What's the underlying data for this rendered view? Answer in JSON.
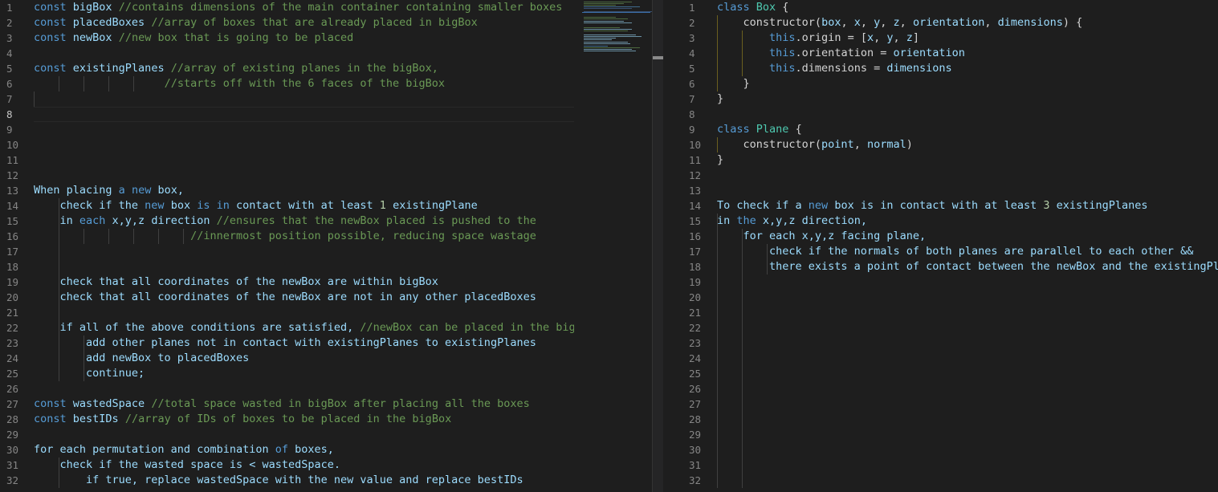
{
  "left_editor": {
    "active_line": 8,
    "lines": [
      {
        "n": "1",
        "t": [
          [
            "kw",
            "const "
          ],
          [
            "var",
            "bigBox "
          ],
          [
            "cmt",
            "//contains dimensions of the main container containing smaller boxes"
          ]
        ]
      },
      {
        "n": "2",
        "t": [
          [
            "kw",
            "const "
          ],
          [
            "var",
            "placedBoxes "
          ],
          [
            "cmt",
            "//array of boxes that are already placed in bigBox"
          ]
        ]
      },
      {
        "n": "3",
        "t": [
          [
            "kw",
            "const "
          ],
          [
            "var",
            "newBox "
          ],
          [
            "cmt",
            "//new box that is going to be placed"
          ]
        ]
      },
      {
        "n": "4",
        "t": []
      },
      {
        "n": "5",
        "t": [
          [
            "kw",
            "const "
          ],
          [
            "var",
            "existingPlanes "
          ],
          [
            "cmt",
            "//array of existing planes in the bigBox,"
          ]
        ]
      },
      {
        "n": "6",
        "t": [
          [
            "",
            "                    "
          ],
          [
            "cmt",
            "//starts off with the 6 faces of the bigBox"
          ]
        ]
      },
      {
        "n": "7",
        "t": []
      },
      {
        "n": "8",
        "t": []
      },
      {
        "n": "9",
        "t": []
      },
      {
        "n": "10",
        "t": []
      },
      {
        "n": "11",
        "t": []
      },
      {
        "n": "12",
        "t": []
      },
      {
        "n": "13",
        "t": [
          [
            "var",
            "When placing "
          ],
          [
            "kw",
            "a "
          ],
          [
            "kw",
            "new "
          ],
          [
            "var",
            "box,"
          ]
        ]
      },
      {
        "n": "14",
        "t": [
          [
            "var",
            "    check if the "
          ],
          [
            "kw",
            "new "
          ],
          [
            "var",
            "box "
          ],
          [
            "kw",
            "is in "
          ],
          [
            "var",
            "contact with at least "
          ],
          [
            "num",
            "1 "
          ],
          [
            "var",
            "existingPlane"
          ]
        ]
      },
      {
        "n": "15",
        "t": [
          [
            "var",
            "    in "
          ],
          [
            "kw",
            "each "
          ],
          [
            "var",
            "x,y,z direction "
          ],
          [
            "cmt",
            "//ensures that the newBox placed is pushed to the"
          ]
        ]
      },
      {
        "n": "16",
        "t": [
          [
            "",
            "                        "
          ],
          [
            "cmt",
            "//innermost position possible, reducing space wastage"
          ]
        ]
      },
      {
        "n": "17",
        "t": []
      },
      {
        "n": "18",
        "t": []
      },
      {
        "n": "19",
        "t": [
          [
            "var",
            "    check that all coordinates of the newBox are within bigBox"
          ]
        ]
      },
      {
        "n": "20",
        "t": [
          [
            "var",
            "    check that all coordinates of the newBox are not in any other placedBoxes"
          ]
        ]
      },
      {
        "n": "21",
        "t": []
      },
      {
        "n": "22",
        "t": [
          [
            "var",
            "    if all of the above conditions are satisfied, "
          ],
          [
            "cmt",
            "//newBox can be placed in the bigBox"
          ]
        ]
      },
      {
        "n": "23",
        "t": [
          [
            "var",
            "        add other planes not in contact with existingPlanes to existingPlanes"
          ]
        ]
      },
      {
        "n": "24",
        "t": [
          [
            "var",
            "        add newBox to placedBoxes"
          ]
        ]
      },
      {
        "n": "25",
        "t": [
          [
            "var",
            "        continue;"
          ]
        ]
      },
      {
        "n": "26",
        "t": []
      },
      {
        "n": "27",
        "t": [
          [
            "kw",
            "const "
          ],
          [
            "var",
            "wastedSpace "
          ],
          [
            "cmt",
            "//total space wasted in bigBox after placing all the boxes"
          ]
        ]
      },
      {
        "n": "28",
        "t": [
          [
            "kw",
            "const "
          ],
          [
            "var",
            "bestIDs "
          ],
          [
            "cmt",
            "//array of IDs of boxes to be placed in the bigBox"
          ]
        ]
      },
      {
        "n": "29",
        "t": []
      },
      {
        "n": "30",
        "t": [
          [
            "var",
            "for each permutation and combination "
          ],
          [
            "kw",
            "of "
          ],
          [
            "var",
            "boxes,"
          ]
        ]
      },
      {
        "n": "31",
        "t": [
          [
            "var",
            "    check if the wasted space is < wastedSpace."
          ]
        ]
      },
      {
        "n": "32",
        "t": [
          [
            "var",
            "        if true, replace wastedSpace with the new value and replace bestIDs"
          ]
        ]
      }
    ]
  },
  "right_editor": {
    "lines": [
      {
        "n": "1",
        "t": [
          [
            "kw",
            "class "
          ],
          [
            "cls",
            "Box "
          ],
          [
            "",
            "{"
          ]
        ]
      },
      {
        "n": "2",
        "t": [
          [
            "",
            "    "
          ],
          [
            "",
            "constructor"
          ],
          [
            "",
            "("
          ],
          [
            "var",
            "box"
          ],
          [
            "",
            ", "
          ],
          [
            "var",
            "x"
          ],
          [
            "",
            ", "
          ],
          [
            "var",
            "y"
          ],
          [
            "",
            ", "
          ],
          [
            "var",
            "z"
          ],
          [
            "",
            ", "
          ],
          [
            "var",
            "orientation"
          ],
          [
            "",
            ", "
          ],
          [
            "var",
            "dimensions"
          ],
          [
            "",
            ") {"
          ]
        ]
      },
      {
        "n": "3",
        "t": [
          [
            "",
            "        "
          ],
          [
            "kw",
            "this"
          ],
          [
            "",
            ".origin = ["
          ],
          [
            "var",
            "x"
          ],
          [
            "",
            ", "
          ],
          [
            "var",
            "y"
          ],
          [
            "",
            ", "
          ],
          [
            "var",
            "z"
          ],
          [
            "",
            "]"
          ]
        ]
      },
      {
        "n": "4",
        "t": [
          [
            "",
            "        "
          ],
          [
            "kw",
            "this"
          ],
          [
            "",
            ".orientation = "
          ],
          [
            "var",
            "orientation"
          ]
        ]
      },
      {
        "n": "5",
        "t": [
          [
            "",
            "        "
          ],
          [
            "kw",
            "this"
          ],
          [
            "",
            ".dimensions = "
          ],
          [
            "var",
            "dimensions"
          ]
        ]
      },
      {
        "n": "6",
        "t": [
          [
            "",
            "    }"
          ]
        ]
      },
      {
        "n": "7",
        "t": [
          [
            "",
            "}"
          ]
        ]
      },
      {
        "n": "8",
        "t": []
      },
      {
        "n": "9",
        "t": [
          [
            "kw",
            "class "
          ],
          [
            "cls",
            "Plane "
          ],
          [
            "",
            "{"
          ]
        ]
      },
      {
        "n": "10",
        "t": [
          [
            "",
            "    constructor("
          ],
          [
            "var",
            "point"
          ],
          [
            "",
            ", "
          ],
          [
            "var",
            "normal"
          ],
          [
            "",
            ")"
          ]
        ]
      },
      {
        "n": "11",
        "t": [
          [
            "",
            "}"
          ]
        ]
      },
      {
        "n": "12",
        "t": []
      },
      {
        "n": "13",
        "t": []
      },
      {
        "n": "14",
        "t": [
          [
            "var",
            "To check if a "
          ],
          [
            "kw",
            "new "
          ],
          [
            "var",
            "box is in contact with at least "
          ],
          [
            "num",
            "3 "
          ],
          [
            "var",
            "existingPlanes"
          ]
        ]
      },
      {
        "n": "15",
        "t": [
          [
            "var",
            "in "
          ],
          [
            "kw",
            "the "
          ],
          [
            "var",
            "x,y,z direction,"
          ]
        ]
      },
      {
        "n": "16",
        "t": [
          [
            "var",
            "    for each x,y,z facing plane,"
          ]
        ]
      },
      {
        "n": "17",
        "t": [
          [
            "var",
            "        check if the normals of both planes are parallel to each other &&"
          ]
        ]
      },
      {
        "n": "18",
        "t": [
          [
            "var",
            "        there exists a point of contact between the newBox and the existingPlane"
          ]
        ]
      },
      {
        "n": "19",
        "t": []
      },
      {
        "n": "20",
        "t": []
      },
      {
        "n": "21",
        "t": []
      },
      {
        "n": "22",
        "t": []
      },
      {
        "n": "23",
        "t": []
      },
      {
        "n": "24",
        "t": []
      },
      {
        "n": "25",
        "t": []
      },
      {
        "n": "26",
        "t": []
      },
      {
        "n": "27",
        "t": []
      },
      {
        "n": "28",
        "t": []
      },
      {
        "n": "29",
        "t": []
      },
      {
        "n": "30",
        "t": []
      },
      {
        "n": "31",
        "t": []
      },
      {
        "n": "32",
        "t": []
      }
    ]
  },
  "colors": {
    "background": "#1e1e1e",
    "keyword": "#569cd6",
    "variable": "#9cdcfe",
    "class_name": "#4ec9b0",
    "comment": "#6a9955",
    "number": "#b5cea8",
    "line_number": "#858585"
  }
}
